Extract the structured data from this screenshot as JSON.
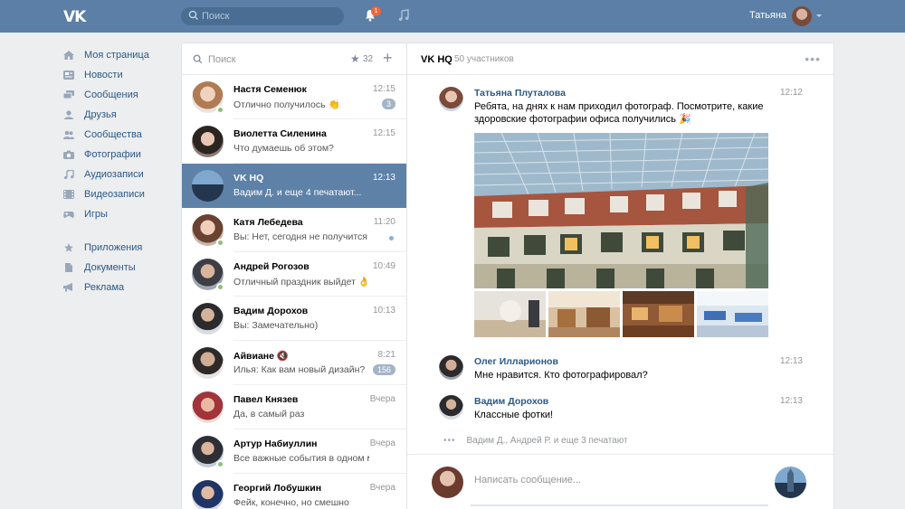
{
  "header": {
    "logo": "VK",
    "search_placeholder": "Поиск",
    "notification_count": "1",
    "user_name": "Татьяна"
  },
  "nav": {
    "items": [
      {
        "label": "Моя страница",
        "icon": "home-icon"
      },
      {
        "label": "Новости",
        "icon": "news-icon"
      },
      {
        "label": "Сообщения",
        "icon": "messages-icon"
      },
      {
        "label": "Друзья",
        "icon": "friends-icon"
      },
      {
        "label": "Сообщества",
        "icon": "communities-icon"
      },
      {
        "label": "Фотографии",
        "icon": "camera-icon"
      },
      {
        "label": "Аудиозаписи",
        "icon": "music-icon"
      },
      {
        "label": "Видеозаписи",
        "icon": "video-icon"
      },
      {
        "label": "Игры",
        "icon": "gamepad-icon"
      }
    ],
    "items2": [
      {
        "label": "Приложения",
        "icon": "star-icon"
      },
      {
        "label": "Документы",
        "icon": "document-icon"
      },
      {
        "label": "Реклама",
        "icon": "megaphone-icon"
      }
    ]
  },
  "dialogs": {
    "search_placeholder": "Поиск",
    "favorites_count": "32",
    "rows": [
      {
        "name": "Настя Семенюк",
        "message": "Отлично получилось 👏",
        "time": "12:15",
        "badge": "3",
        "online": true
      },
      {
        "name": "Виолетта Силенина",
        "message": "Что думаешь об этом?",
        "time": "12:15",
        "badge": "",
        "online": false
      },
      {
        "name": "VK HQ",
        "message": "Вадим Д. и еще 4 печатают...",
        "time": "12:13",
        "badge": "",
        "online": false,
        "active": true
      },
      {
        "name": "Катя Лебедева",
        "message": "Вы: Нет, сегодня не получится",
        "time": "11:20",
        "badge": "",
        "online": true,
        "unread_dot": true
      },
      {
        "name": "Андрей Рогозов",
        "message": "Отличный праздник выйдет 👌",
        "time": "10:49",
        "badge": "",
        "online": true
      },
      {
        "name": "Вадим Дорохов",
        "message": "Вы: Замечательно)",
        "time": "10:13",
        "badge": "",
        "online": false
      },
      {
        "name": "Айвиане 🔇",
        "message": "Илья: Как вам новый дизайн?",
        "time": "8:21",
        "badge": "156",
        "online": false
      },
      {
        "name": "Павел Князев",
        "message": "Да, в самый раз",
        "time": "Вчера",
        "badge": "",
        "online": false
      },
      {
        "name": "Артур Набиуллин",
        "message": "Все важные события в одном месте",
        "time": "Вчера",
        "badge": "",
        "online": true
      },
      {
        "name": "Георгий Лобушкин",
        "message": "Фейк, конечно, но смешно",
        "time": "Вчера",
        "badge": "",
        "online": false
      }
    ]
  },
  "chat": {
    "title": "VK HQ",
    "members": "50 участников",
    "messages": [
      {
        "author": "Татьяна Плуталова",
        "time": "12:12",
        "text": "Ребята, на днях к нам приходил фотограф. Посмотрите, какие здоровские фотографии офиса получились 🎉"
      },
      {
        "author": "Олег Илларионов",
        "time": "12:13",
        "text": "Мне нравится. Кто фотографировал?"
      },
      {
        "author": "Вадим Дорохов",
        "time": "12:13",
        "text": "Классные фотки!"
      }
    ],
    "typing": "Вадим Д., Андрей Р. и еще 3 печатают",
    "composer_placeholder": "Написать сообщение..."
  }
}
